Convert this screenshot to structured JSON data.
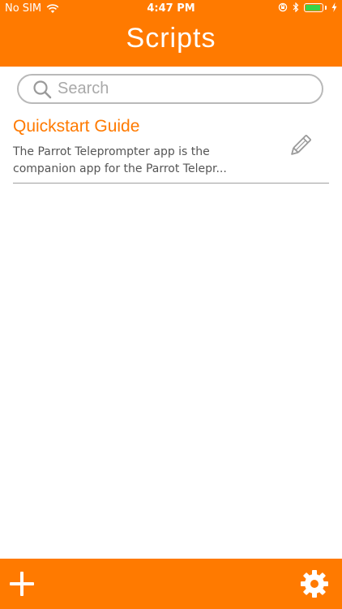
{
  "status_bar": {
    "carrier": "No SIM",
    "time": "4:47 PM",
    "battery_level": 0.9
  },
  "header": {
    "title": "Scripts"
  },
  "search": {
    "placeholder": "Search",
    "value": ""
  },
  "scripts": [
    {
      "title": "Quickstart Guide",
      "preview": "The Parrot Teleprompter app is the companion app for the Parrot Telepr..."
    }
  ],
  "icons": {
    "search": "search-icon",
    "edit": "pencil-icon",
    "add": "plus-icon",
    "settings": "gear-icon"
  },
  "colors": {
    "accent": "#ff7a00",
    "divider": "#a0a0a0",
    "search_border": "#b9b9b9"
  }
}
